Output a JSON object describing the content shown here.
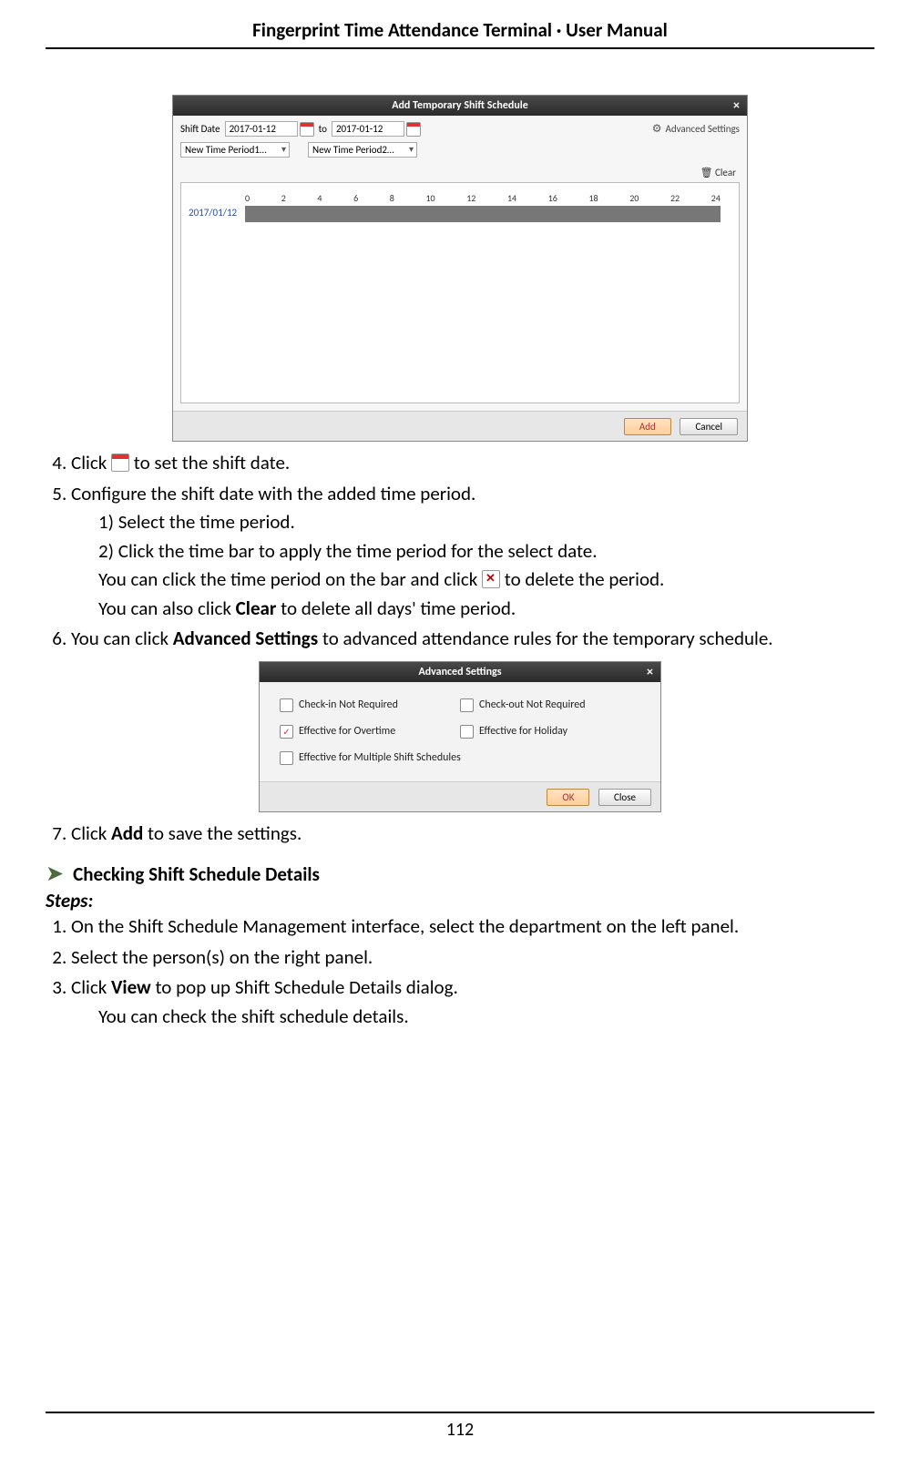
{
  "header": {
    "title": "Fingerprint Time Attendance Terminal · User Manual"
  },
  "footer": {
    "page_number": "112"
  },
  "dialog1": {
    "title": "Add Temporary Shift Schedule",
    "shift_date_label": "Shift Date",
    "date_from": "2017-01-12",
    "date_to_label": "to",
    "date_to": "2017-01-12",
    "advanced_label": "Advanced Settings",
    "period1": "New Time Period1…",
    "period2": "New Time Period2…",
    "clear_label": "Clear",
    "timeline_date": "2017/01/12",
    "ticks": [
      "0",
      "2",
      "4",
      "6",
      "8",
      "10",
      "12",
      "14",
      "16",
      "18",
      "20",
      "22",
      "24"
    ],
    "add_btn": "Add",
    "cancel_btn": "Cancel"
  },
  "dialog2": {
    "title": "Advanced Settings",
    "items": [
      {
        "label": "Check-in Not Required",
        "checked": false
      },
      {
        "label": "Check-out Not Required",
        "checked": false
      },
      {
        "label": "Effective for Overtime",
        "checked": true
      },
      {
        "label": "Effective for Holiday",
        "checked": false
      },
      {
        "label": "Effective for Multiple Shift Schedules",
        "checked": false
      }
    ],
    "ok_btn": "OK",
    "close_btn": "Close"
  },
  "text": {
    "step4_a": "Click ",
    "step4_b": " to set the shift date.",
    "step5": "Configure the shift date with the added time period.",
    "step5_1": "1)   Select the time period.",
    "step5_2": "2)   Click the time bar to apply the time period for the select date.",
    "step5_note1_a": "You can click the time period on the bar and click ",
    "step5_note1_b": " to delete the period.",
    "step5_note2_a": "You can also click ",
    "step5_note2_bold": "Clear",
    "step5_note2_b": " to delete all days' time period.",
    "step6_a": "You can click ",
    "step6_bold": "Advanced Settings",
    "step6_b": " to advanced attendance rules for the temporary schedule.",
    "step7_a": "Click ",
    "step7_bold": "Add",
    "step7_b": " to save the settings.",
    "section2_title": "Checking Shift Schedule Details",
    "steps_label": "Steps:",
    "s2_1": "On the Shift Schedule Management interface, select the department on the left panel.",
    "s2_2": "Select the person(s) on the right panel.",
    "s2_3_a": "Click ",
    "s2_3_bold": "View",
    "s2_3_b": " to pop up Shift Schedule Details dialog.",
    "s2_3_note": "You can check the shift schedule details."
  }
}
